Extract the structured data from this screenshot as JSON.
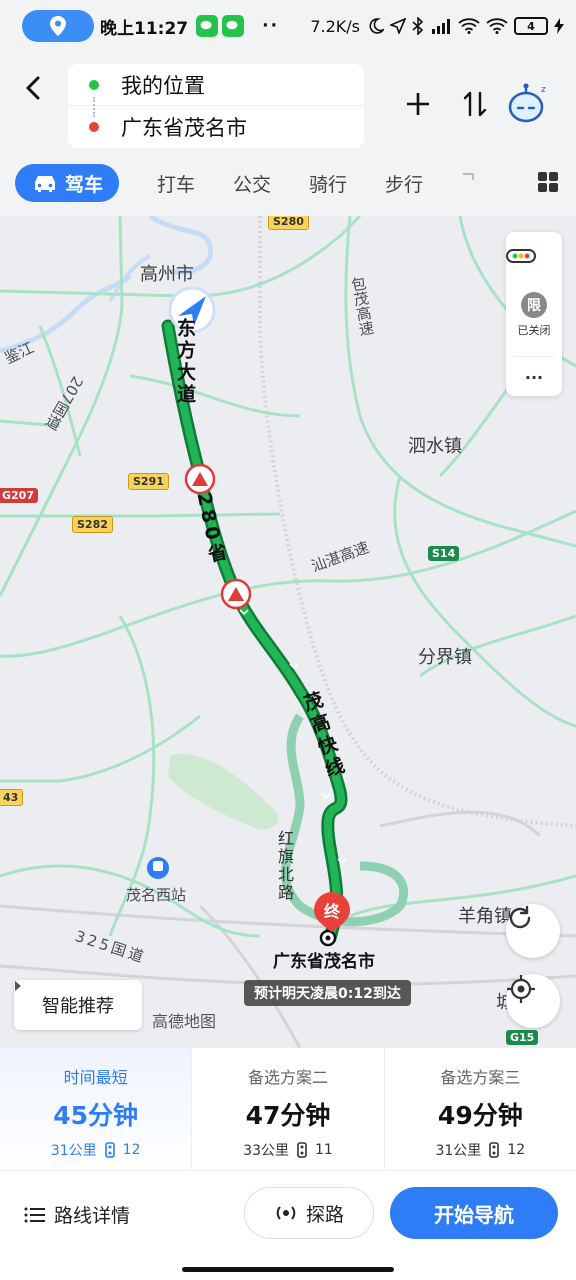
{
  "status_bar": {
    "time": "晚上11:27",
    "more": "··",
    "net_speed": "7.2K/s",
    "battery": "4"
  },
  "header": {
    "origin": "我的位置",
    "destination": "广东省茂名市",
    "modes": [
      "驾车",
      "打车",
      "公交",
      "骑行",
      "步行"
    ]
  },
  "map": {
    "places": {
      "gaozhou": "高州市",
      "sishui": "泗水镇",
      "fenjie": "分界镇",
      "maoming_west": "茂名西站",
      "yangjiao": "羊角镇",
      "jianjiang": "鉴江",
      "cheng": "城"
    },
    "roads": {
      "dongfang": "东方大道",
      "s280": "280省",
      "maogao": "茂高快线",
      "hongqi": "红旗北路",
      "baomao": "包茂高速",
      "shanzhan": "汕湛高速",
      "g207": "207国道",
      "g325": "325国道"
    },
    "shields": {
      "s280": "S280",
      "s291": "S291",
      "s282": "S282",
      "g207": "G207",
      "s14": "S14",
      "n43": "43",
      "g15": "G15"
    },
    "side_panel": {
      "limit": "限",
      "limit_status": "已关闭",
      "more": "···"
    },
    "end_marker": "终",
    "destination_label": "广东省茂名市",
    "eta": "预计明天凌晨0:12到达",
    "smart_recommend": "智能推荐",
    "brand": "高德地图"
  },
  "routes": [
    {
      "tag": "时间最短",
      "time": "45分钟",
      "distance": "31公里",
      "lights": "12"
    },
    {
      "tag": "备选方案二",
      "time": "47分钟",
      "distance": "33公里",
      "lights": "11"
    },
    {
      "tag": "备选方案三",
      "time": "49分钟",
      "distance": "31公里",
      "lights": "12"
    }
  ],
  "actions": {
    "details": "路线详情",
    "explore": "探路",
    "start": "开始导航"
  },
  "colors": {
    "accent": "#2e7cf6",
    "route_main": "#1aa34a",
    "route_alt": "#8fcfb2",
    "road": "#a8e2c4"
  }
}
